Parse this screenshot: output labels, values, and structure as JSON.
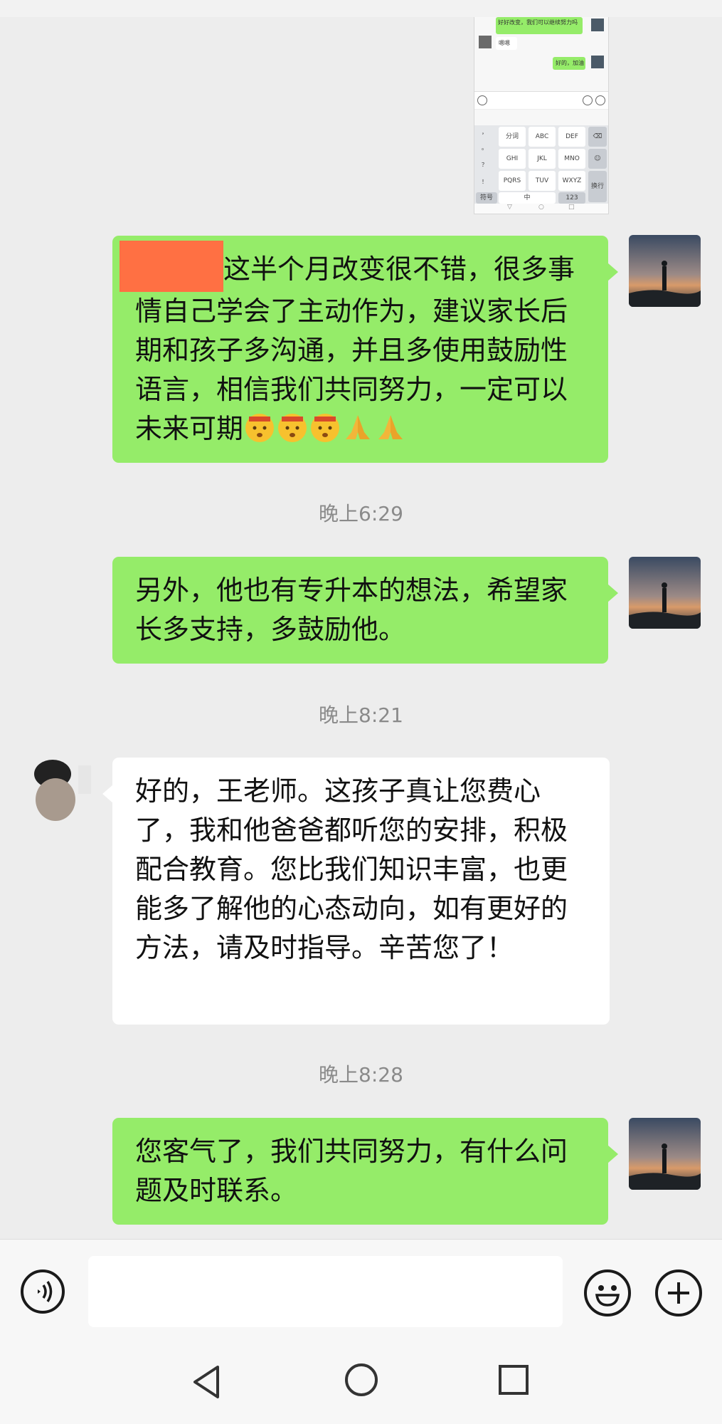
{
  "embedded_screenshot": {
    "top_bubble_text": "好好改变，我们可以继续努力吗",
    "small_reply": "嗯嗯",
    "small_reply_right": "好的，加油",
    "keys_row1": [
      "分词",
      "ABC",
      "DEF"
    ],
    "keys_row2": [
      "GHI",
      "JKL",
      "MNO"
    ],
    "keys_row3": [
      "PQRS",
      "TUV",
      "WXYZ"
    ],
    "side_keys": [
      "，",
      "。",
      "？",
      "！"
    ],
    "bottom_keys": [
      "符号",
      "中",
      "123"
    ],
    "enter_key": "换行"
  },
  "messages": [
    {
      "sender": "me",
      "text": "这半个月改变很不错，很多事情自己学会了主动作为，建议家长后期和孩子多沟通，并且多使用鼓励性语言，相信我们共同努力，一定可以未来可期",
      "emojis": [
        "hushed-face",
        "hushed-face",
        "hushed-face",
        "folded-hands",
        "folded-hands"
      ]
    },
    {
      "timestamp": "晚上6:29"
    },
    {
      "sender": "me",
      "text": "另外，他也有专升本的想法，希望家长多支持，多鼓励他。"
    },
    {
      "timestamp": "晚上8:21"
    },
    {
      "sender": "other",
      "text": "好的，王老师。这孩子真让您费心了，我和他爸爸都听您的安排，积极配合教育。您比我们知识丰富，也更能多了解他的心态动向，如有更好的方法，请及时指导。辛苦您了！"
    },
    {
      "timestamp": "晚上8:28"
    },
    {
      "sender": "me",
      "text": "您客气了，我们共同努力，有什么问题及时联系。"
    }
  ],
  "input_bar": {
    "voice_icon": "voice-icon",
    "emoji_icon": "emoji-icon",
    "plus_icon": "plus-icon",
    "text_value": ""
  },
  "nav": [
    "back-icon",
    "home-icon",
    "recents-icon"
  ],
  "colors": {
    "my_bubble": "#95ec69",
    "other_bubble": "#ffffff",
    "background": "#ededed",
    "redaction": "#ff7043"
  }
}
